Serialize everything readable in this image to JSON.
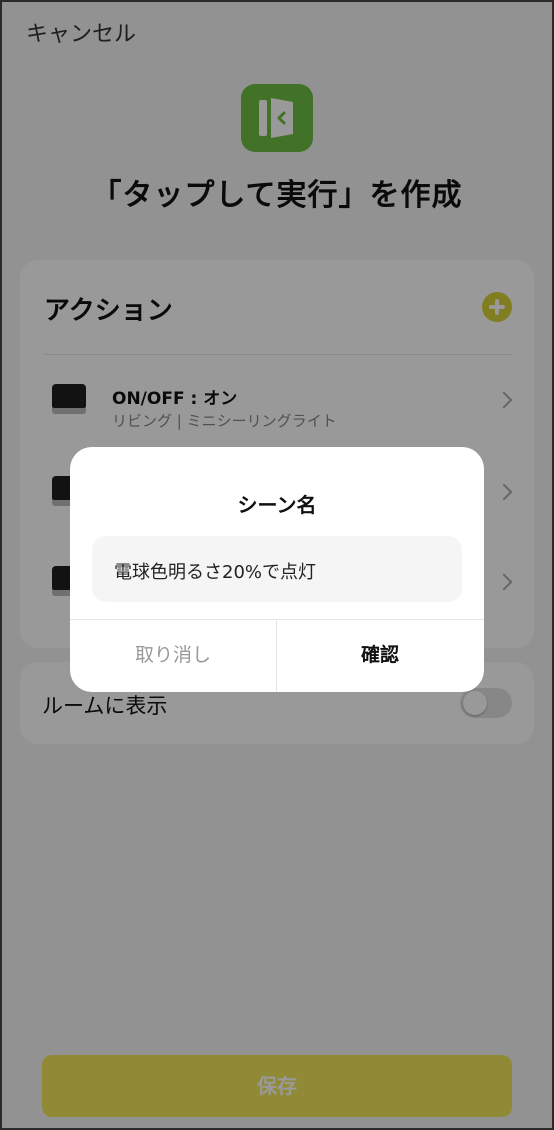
{
  "header": {
    "cancel_label": "キャンセル",
    "title": "「タップして実行」を作成",
    "icon": "door-exit-icon"
  },
  "actions": {
    "heading": "アクション",
    "add_icon": "plus-circle-icon",
    "items": [
      {
        "title": "ON/OFF : オン",
        "subtitle": "リビング | ミニシーリングライト",
        "icon": "ceiling-light-icon"
      },
      {
        "title": "",
        "subtitle": "",
        "icon": "ceiling-light-icon"
      },
      {
        "title": "",
        "subtitle": "",
        "icon": "ceiling-light-icon"
      }
    ]
  },
  "room": {
    "label": "ルームに表示",
    "toggle_on": false
  },
  "footer": {
    "save_label": "保存"
  },
  "dialog": {
    "title": "シーン名",
    "input_value": "電球色明るさ20%で点灯",
    "cancel_label": "取り消し",
    "confirm_label": "確認"
  },
  "colors": {
    "accent": "#f0e75a",
    "icon_green": "#6fbf44"
  }
}
